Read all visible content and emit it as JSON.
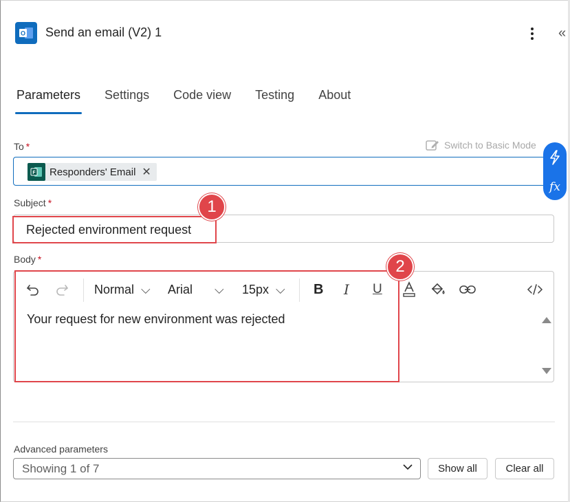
{
  "header": {
    "title": "Send an email (V2) 1",
    "app_icon": "outlook-icon",
    "more_icon": "more-vertical-icon",
    "collapse_icon": "double-chevron-left-icon"
  },
  "tabs": [
    {
      "label": "Parameters",
      "active": true
    },
    {
      "label": "Settings",
      "active": false
    },
    {
      "label": "Code view",
      "active": false
    },
    {
      "label": "Testing",
      "active": false
    },
    {
      "label": "About",
      "active": false
    }
  ],
  "to": {
    "label": "To",
    "required_mark": "*",
    "switch_mode": "Switch to Basic Mode",
    "token": "Responders' Email",
    "token_close": "✕"
  },
  "subject": {
    "label": "Subject",
    "required_mark": "*",
    "value": "Rejected environment request"
  },
  "body": {
    "label": "Body",
    "required_mark": "*",
    "format": "Normal",
    "font": "Arial",
    "size": "15px",
    "text": "Your request for new environment was rejected"
  },
  "annotations": {
    "badge_1": "1",
    "badge_2": "2"
  },
  "advanced": {
    "label": "Advanced parameters",
    "select_value": "Showing 1 of 7",
    "show_all": "Show all",
    "clear_all": "Clear all"
  },
  "colors": {
    "accent": "#0f6cbd",
    "annotation": "#e0454a",
    "required": "#c50f1f"
  }
}
